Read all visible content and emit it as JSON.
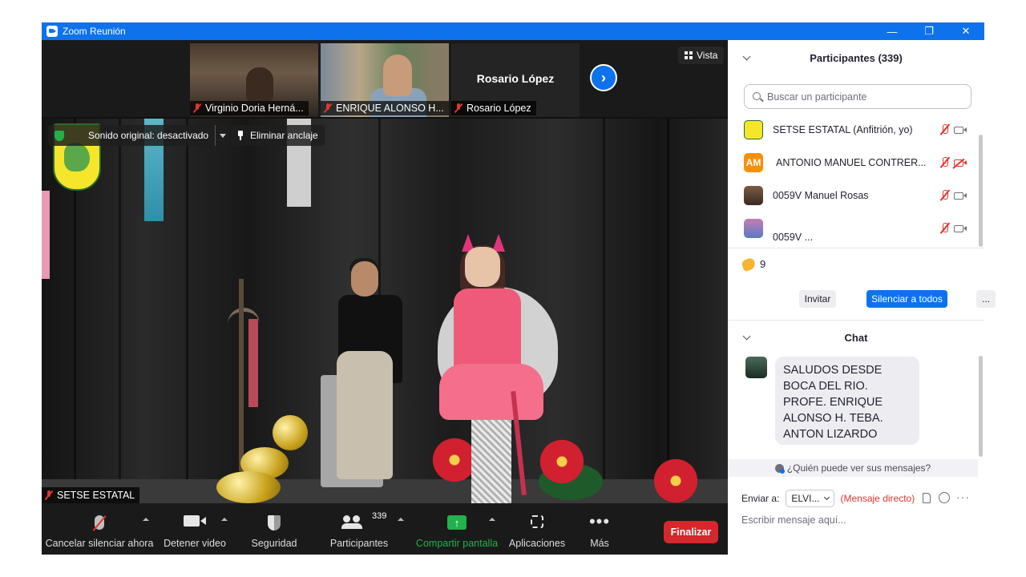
{
  "window": {
    "title": "Zoom Reunión",
    "minimize": "—",
    "restore": "❐",
    "close": "✕"
  },
  "thumbnails": [
    {
      "name": "Virginio Doria Herná..."
    },
    {
      "name": "ENRIQUE ALONSO H..."
    },
    {
      "name": "Rosario López",
      "display_name": "Rosario López"
    }
  ],
  "view_button": "Vista",
  "next_arrow": "›",
  "overlay": {
    "original_sound": "Sonido original: desactivado",
    "unpin": "Eliminar anclaje"
  },
  "main_video": {
    "speaker_name": "SETSE ESTATAL"
  },
  "toolbar": {
    "mute": "Cancelar silenciar ahora",
    "video": "Detener video",
    "security": "Seguridad",
    "participants": "Participantes",
    "participants_count": "339",
    "share": "Compartir pantalla",
    "share_icon": "↑",
    "apps": "Aplicaciones",
    "more": "Más",
    "more_icon": "•••",
    "end": "Finalizar"
  },
  "participants_panel": {
    "title": "Participantes (339)",
    "search_placeholder": "Buscar un participante",
    "items": [
      {
        "initials": "",
        "name": "SETSE ESTATAL (Anfitrión, yo)",
        "video_off": false
      },
      {
        "initials": "AM",
        "name": "ANTONIO MANUEL CONTRER...",
        "video_off": true
      },
      {
        "initials": "",
        "name": "0059V Manuel Rosas",
        "video_off": false
      },
      {
        "initials": "",
        "name": "0059V ...",
        "video_off": false
      }
    ],
    "reactions_count": "9",
    "invite": "Invitar",
    "mute_all": "Silenciar a todos",
    "more": "..."
  },
  "chat": {
    "title": "Chat",
    "message": "SALUDOS DESDE BOCA DEL RIO.  PROFE. ENRIQUE ALONSO H. TEBA.  ANTON LIZARDO",
    "who_can_see": "¿Quién puede ver sus mensajes?",
    "send_to_label": "Enviar a:",
    "send_to_value": "ELVI...",
    "direct_message": "(Mensaje directo)",
    "input_placeholder": "Escribir mensaje aquí...",
    "more_icon": "···"
  },
  "colors": {
    "accent": "#0e72ed",
    "end_button": "#d6272c",
    "share_green": "#22b14c",
    "muted_red": "#e0362e"
  }
}
